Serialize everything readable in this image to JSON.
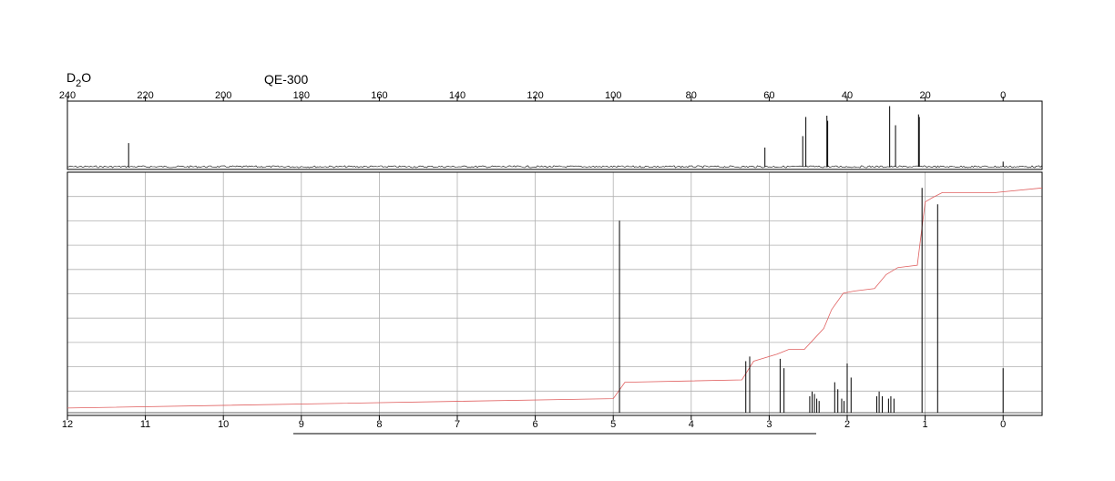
{
  "solvent_label": "D",
  "solvent_sub": "2",
  "solvent_tail": "O",
  "instrument": "QE-300",
  "chart_data": [
    {
      "type": "line",
      "panel": "13C spectrum",
      "xlim": [
        240,
        -10
      ],
      "xticks": [
        "240",
        "220",
        "200",
        "180",
        "160",
        "140",
        "120",
        "100",
        "80",
        "60",
        "40",
        "20",
        "0"
      ],
      "xtick_values": [
        240,
        220,
        200,
        180,
        160,
        140,
        120,
        100,
        80,
        60,
        40,
        20,
        0
      ],
      "peaks": [
        {
          "x": 224.3,
          "h": 0.37
        },
        {
          "x": 61.1,
          "h": 0.3
        },
        {
          "x": 51.4,
          "h": 0.48
        },
        {
          "x": 50.6,
          "h": 0.78
        },
        {
          "x": 45.2,
          "h": 0.8
        },
        {
          "x": 45.0,
          "h": 0.72
        },
        {
          "x": 29.1,
          "h": 0.95
        },
        {
          "x": 27.6,
          "h": 0.65
        },
        {
          "x": 21.7,
          "h": 0.82
        },
        {
          "x": 21.5,
          "h": 0.78
        },
        {
          "x": 0.0,
          "h": 0.08
        }
      ]
    },
    {
      "type": "line",
      "panel": "1H spectrum",
      "xlim": [
        12,
        -0.5
      ],
      "xticks": [
        "12",
        "11",
        "10",
        "9",
        "8",
        "7",
        "6",
        "5",
        "4",
        "3",
        "2",
        "1",
        "0"
      ],
      "xtick_values": [
        12,
        11,
        10,
        9,
        8,
        7,
        6,
        5,
        4,
        3,
        2,
        1,
        0
      ],
      "grid": true,
      "peaks": [
        {
          "x": 4.92,
          "h": 0.82
        },
        {
          "x": 3.3,
          "h": 0.22
        },
        {
          "x": 3.25,
          "h": 0.24
        },
        {
          "x": 2.86,
          "h": 0.23
        },
        {
          "x": 2.81,
          "h": 0.19
        },
        {
          "x": 2.48,
          "h": 0.07
        },
        {
          "x": 2.45,
          "h": 0.09
        },
        {
          "x": 2.42,
          "h": 0.08
        },
        {
          "x": 2.39,
          "h": 0.06
        },
        {
          "x": 2.36,
          "h": 0.05
        },
        {
          "x": 2.16,
          "h": 0.13
        },
        {
          "x": 2.12,
          "h": 0.1
        },
        {
          "x": 2.07,
          "h": 0.06
        },
        {
          "x": 2.04,
          "h": 0.05
        },
        {
          "x": 2.0,
          "h": 0.21
        },
        {
          "x": 1.95,
          "h": 0.15
        },
        {
          "x": 1.62,
          "h": 0.07
        },
        {
          "x": 1.59,
          "h": 0.09
        },
        {
          "x": 1.55,
          "h": 0.07
        },
        {
          "x": 1.47,
          "h": 0.06
        },
        {
          "x": 1.44,
          "h": 0.07
        },
        {
          "x": 1.4,
          "h": 0.06
        },
        {
          "x": 1.04,
          "h": 0.96
        },
        {
          "x": 0.84,
          "h": 0.89
        },
        {
          "x": 0.0,
          "h": 0.19
        }
      ],
      "integral": [
        {
          "x": 12.0,
          "y": 0.02
        },
        {
          "x": 5.0,
          "y": 0.06
        },
        {
          "x": 4.85,
          "y": 0.13
        },
        {
          "x": 3.35,
          "y": 0.14
        },
        {
          "x": 3.2,
          "y": 0.22
        },
        {
          "x": 2.9,
          "y": 0.25
        },
        {
          "x": 2.75,
          "y": 0.27
        },
        {
          "x": 2.55,
          "y": 0.27
        },
        {
          "x": 2.3,
          "y": 0.36
        },
        {
          "x": 2.2,
          "y": 0.44
        },
        {
          "x": 2.05,
          "y": 0.51
        },
        {
          "x": 1.9,
          "y": 0.52
        },
        {
          "x": 1.65,
          "y": 0.53
        },
        {
          "x": 1.5,
          "y": 0.59
        },
        {
          "x": 1.35,
          "y": 0.62
        },
        {
          "x": 1.1,
          "y": 0.63
        },
        {
          "x": 1.0,
          "y": 0.9
        },
        {
          "x": 0.9,
          "y": 0.92
        },
        {
          "x": 0.78,
          "y": 0.94
        },
        {
          "x": 0.1,
          "y": 0.94
        },
        {
          "x": -0.5,
          "y": 0.96
        }
      ]
    }
  ]
}
